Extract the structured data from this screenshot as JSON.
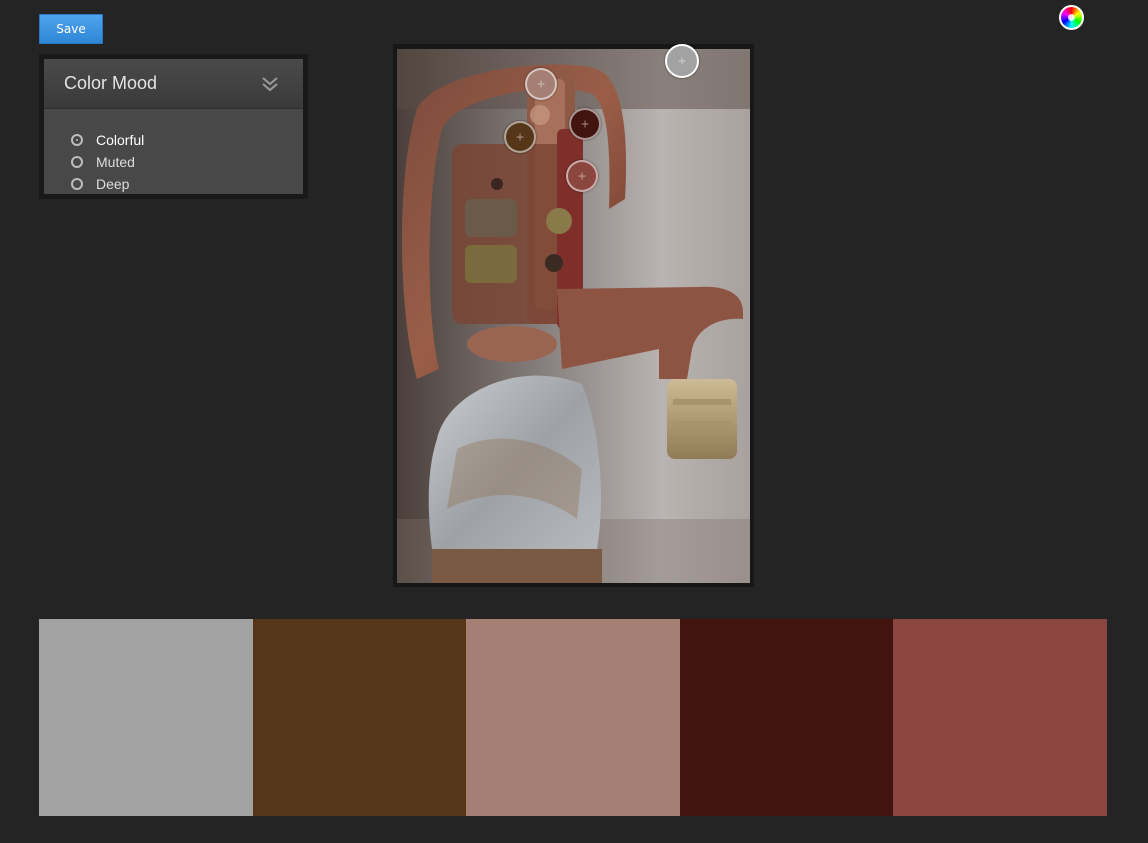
{
  "toolbar": {
    "save_label": "Save"
  },
  "color_wheel": {
    "icon": "color-wheel-icon"
  },
  "color_mood": {
    "title": "Color Mood",
    "collapse_icon": "double-chevron-down-icon",
    "options": [
      {
        "label": "Colorful",
        "selected": true
      },
      {
        "label": "Muted",
        "selected": false
      },
      {
        "label": "Deep",
        "selected": false
      }
    ]
  },
  "swatches": [
    {
      "color": "#a2a2a2"
    },
    {
      "color": "#553618"
    },
    {
      "color": "#a57f74"
    },
    {
      "color": "#42140f"
    },
    {
      "color": "#8b473f"
    }
  ],
  "pickers": [
    {
      "color": "#a2a2a2",
      "active": true
    },
    {
      "color": "#553618",
      "active": false
    },
    {
      "color": "#a57f74",
      "active": false
    },
    {
      "color": "#42140f",
      "active": false
    },
    {
      "color": "#8b473f",
      "active": false
    }
  ]
}
